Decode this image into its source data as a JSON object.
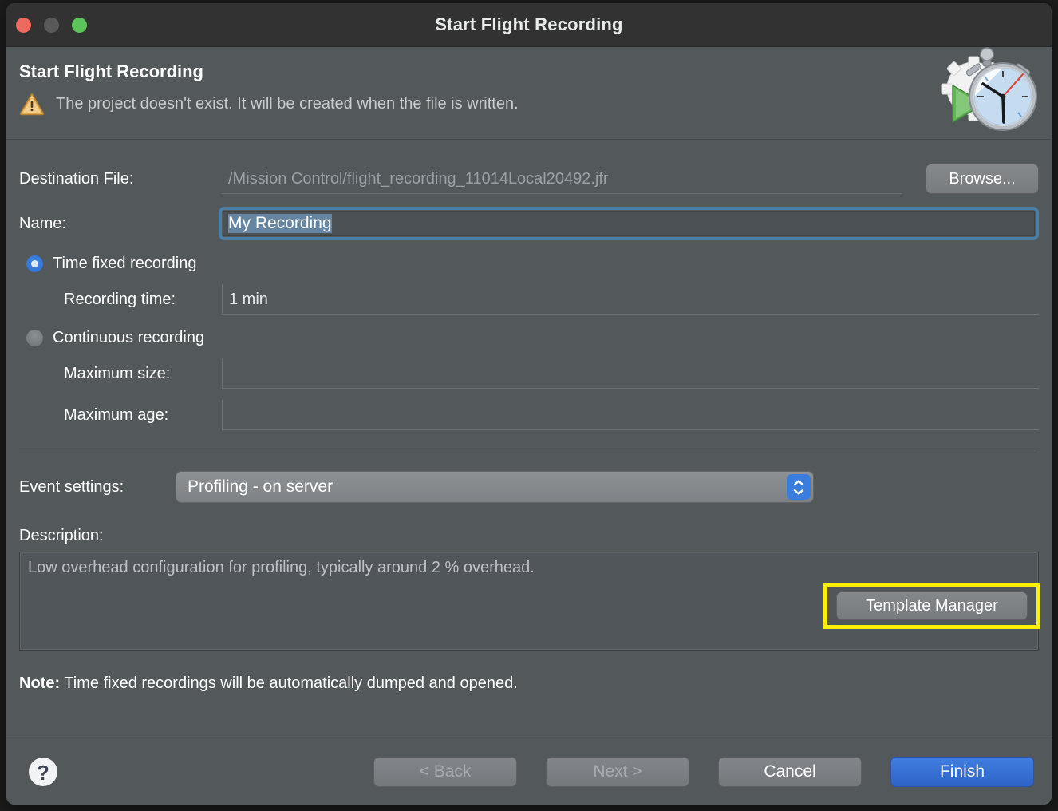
{
  "window": {
    "title": "Start Flight Recording",
    "traffic_lights": [
      "close-button",
      "minimize-button",
      "zoom-button"
    ]
  },
  "header": {
    "title": "Start Flight Recording",
    "message": "The project doesn't exist. It will be created when the file is written.",
    "icon": "warning-icon",
    "art_icon": "stopwatch-record-icon"
  },
  "form": {
    "destination": {
      "label": "Destination File:",
      "value": "/Mission Control/flight_recording_11014Local20492.jfr",
      "browse_label": "Browse..."
    },
    "name": {
      "label": "Name:",
      "value": "My Recording"
    },
    "time_fixed": {
      "label": "Time fixed recording",
      "selected": true,
      "recording_time_label": "Recording time:",
      "recording_time_value": "1 min"
    },
    "continuous": {
      "label": "Continuous recording",
      "selected": false,
      "max_size_label": "Maximum size:",
      "max_size_value": "",
      "max_age_label": "Maximum age:",
      "max_age_value": ""
    }
  },
  "event_settings": {
    "label": "Event settings:",
    "selected": "Profiling - on server",
    "template_manager_label": "Template Manager",
    "highlight_color": "#ffef00"
  },
  "description": {
    "label": "Description:",
    "text": "Low overhead configuration for profiling, typically around 2 % overhead."
  },
  "note": {
    "label": "Note:",
    "text": "Time fixed recordings will be automatically dumped and opened."
  },
  "footer": {
    "help_label": "?",
    "back_label": "< Back",
    "next_label": "Next >",
    "cancel_label": "Cancel",
    "finish_label": "Finish",
    "primary_color": "#3f7ee0"
  }
}
